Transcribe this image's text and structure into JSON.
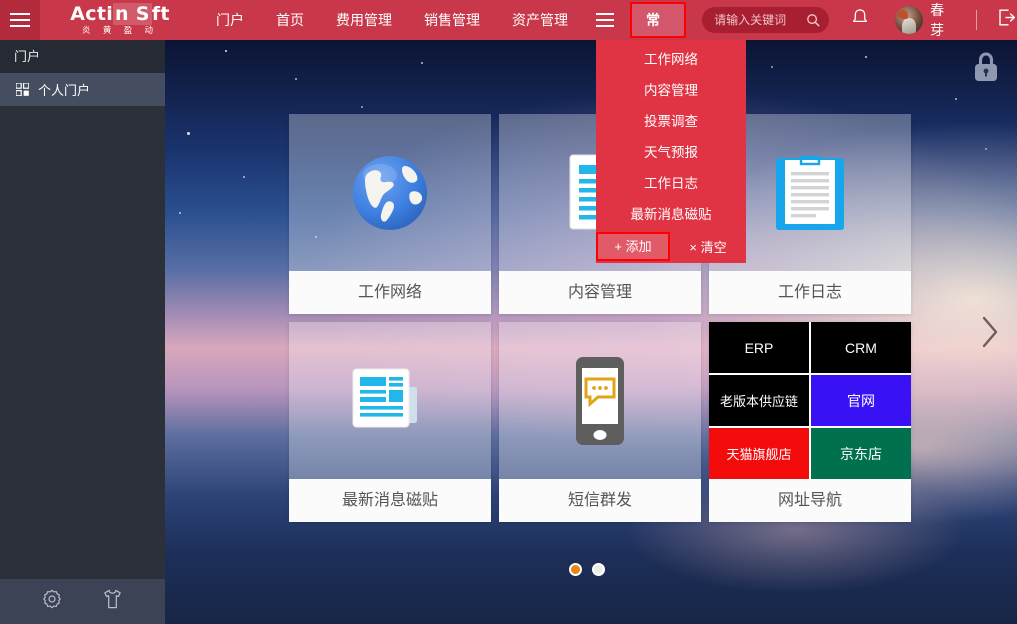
{
  "topbar": {
    "menu_icon": "hamburger-icon",
    "brand_name_part1": "Acti",
    "brand_name_part2": "n S",
    "brand_name_part3": "ft",
    "brand_subtitle": "炎 黄 盈 动",
    "nav": [
      {
        "label": "门户"
      },
      {
        "label": "首页"
      },
      {
        "label": "费用管理"
      },
      {
        "label": "销售管理"
      },
      {
        "label": "资产管理"
      }
    ],
    "nav_more_icon": "hamburger-icon",
    "active_button": "常用",
    "search": {
      "placeholder": "请输入关键词",
      "value": "",
      "icon": "search-icon"
    },
    "bell_icon": "bell-icon",
    "username": "春芽",
    "logout_icon": "logout-icon"
  },
  "dropdown": {
    "items": [
      {
        "label": "工作网络"
      },
      {
        "label": "内容管理"
      },
      {
        "label": "投票调查"
      },
      {
        "label": "天气预报"
      },
      {
        "label": "工作日志"
      },
      {
        "label": "最新消息磁贴"
      }
    ],
    "add_label": "+ 添加",
    "clear_label": "× 清空"
  },
  "sidebar": {
    "title": "门户",
    "items": [
      {
        "label": "个人门户",
        "icon": "grid-icon"
      }
    ],
    "bottom_icons": [
      {
        "name": "gear-icon"
      },
      {
        "name": "tshirt-icon"
      }
    ]
  },
  "desktop": {
    "lock_icon": "lock-icon",
    "next_arrow_icon": "chevron-right-icon",
    "cards": [
      {
        "title": "工作网络",
        "icon": "globe-icon"
      },
      {
        "title": "内容管理",
        "icon": "document-icon"
      },
      {
        "title": "工作日志",
        "icon": "clipboard-icon"
      },
      {
        "title": "最新消息磁贴",
        "icon": "news-icon"
      },
      {
        "title": "短信群发",
        "icon": "phone-sms-icon"
      }
    ],
    "link_card": {
      "title": "网址导航",
      "tiles": [
        {
          "label": "ERP",
          "color": "#000000"
        },
        {
          "label": "CRM",
          "color": "#000000"
        },
        {
          "label": "老版本供应链",
          "color": "#000000"
        },
        {
          "label": "官网",
          "color": "#3a10f5"
        },
        {
          "label": "天猫旗舰店",
          "color": "#f40b0b"
        },
        {
          "label": "京东店",
          "color": "#00704f"
        }
      ]
    },
    "pager": {
      "pages": 2,
      "active": 1,
      "active_color": "#e8860e",
      "inactive_color": "#ececec"
    }
  },
  "colors": {
    "topbar_red": "#c8384a",
    "dropdown_red": "#e03444",
    "highlight_border": "#ff0000",
    "sidebar_dark": "#3b4354"
  }
}
